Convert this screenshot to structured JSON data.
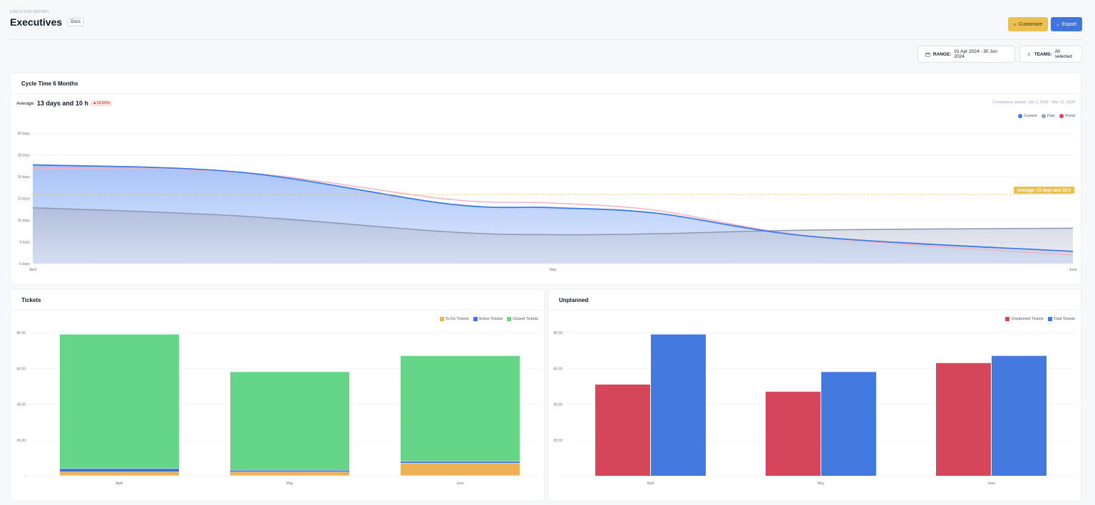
{
  "header": {
    "eyebrow": "EXECUTIVE REPORT",
    "title": "Executives",
    "docs_label": "Docs",
    "customize_label": "Customize",
    "export_label": "Export"
  },
  "filters": {
    "range_label": "RANGE:",
    "range_value": "01 Apr 2024 - 30 Jun 2024",
    "teams_label": "TEAMS:",
    "teams_value": "All selected"
  },
  "cycle": {
    "title": "Cycle Time 6 Months",
    "average_label": "Average:",
    "average_value": "13 days and 10 h",
    "change": "▲18.99%",
    "comparison": "Comparison period: Jan 1, 2024 - Mar 31, 2024",
    "average_annotation": "Average: 13 days and 10 h"
  },
  "tickets": {
    "title": "Tickets"
  },
  "unplanned": {
    "title": "Unplanned"
  },
  "colors": {
    "current": "#3f7ae6",
    "past": "#9aa3bd",
    "trend": "#d9425a",
    "todo": "#eeb254",
    "active": "#4274e0",
    "closed": "#65d687",
    "unplanned": "#d5465a",
    "total": "#4479e0"
  },
  "chart_data": [
    {
      "type": "area",
      "categories": [
        "April",
        "May",
        "June"
      ],
      "y_ticks": [
        "6 days",
        "9 days",
        "11 days",
        "13 days",
        "16 days",
        "18 days",
        "20 days"
      ],
      "ylim": [
        6,
        20
      ],
      "average": 13.42,
      "series": [
        {
          "name": "Current",
          "x": [
            0,
            0.2,
            0.4,
            0.5,
            0.6,
            0.75,
            1
          ],
          "values": [
            16.6,
            15.8,
            12.4,
            12.0,
            11.4,
            8.9,
            7.3
          ]
        },
        {
          "name": "Past",
          "x": [
            0,
            0.2,
            0.4,
            0.5,
            0.6,
            0.75,
            1
          ],
          "values": [
            12.0,
            11.1,
            9.4,
            9.1,
            9.2,
            9.6,
            9.8
          ]
        },
        {
          "name": "Trend",
          "x": [
            0,
            0.2,
            0.4,
            0.5,
            0.6,
            0.75,
            1
          ],
          "values": [
            16.2,
            15.8,
            12.9,
            12.5,
            11.7,
            8.9,
            6.9
          ]
        }
      ]
    },
    {
      "type": "bar",
      "stacked": true,
      "categories": [
        "April",
        "May",
        "June"
      ],
      "y_ticks": [
        "-",
        "20.00",
        "40.00",
        "60.00",
        "80.00"
      ],
      "ylim": [
        0,
        80
      ],
      "series": [
        {
          "name": "To Do Tickets",
          "values": [
            2,
            2,
            7
          ]
        },
        {
          "name": "Active Tickets",
          "values": [
            2,
            1,
            1
          ]
        },
        {
          "name": "Closed Tickets",
          "values": [
            75,
            55,
            59
          ]
        }
      ]
    },
    {
      "type": "bar",
      "categories": [
        "April",
        "May",
        "June"
      ],
      "y_ticks": [
        "-",
        "20.00",
        "40.00",
        "60.00",
        "80.00"
      ],
      "ylim": [
        0,
        80
      ],
      "series": [
        {
          "name": "Unplanned Tickets",
          "values": [
            51,
            47,
            63
          ]
        },
        {
          "name": "Total Tickets",
          "values": [
            79,
            58,
            67
          ]
        }
      ]
    }
  ]
}
